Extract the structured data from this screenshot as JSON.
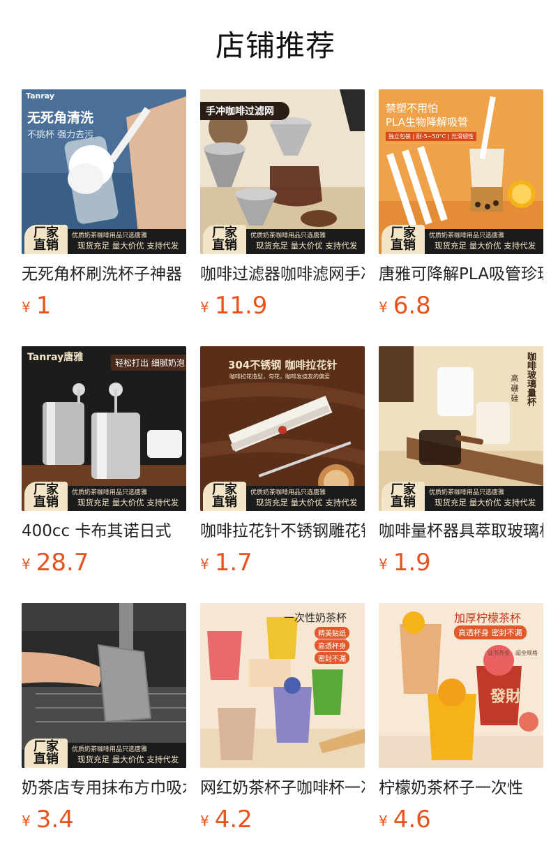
{
  "page": {
    "title": "店铺推荐"
  },
  "banner": {
    "badge_line1": "厂家",
    "badge_line2": "直销",
    "top_text": "优质奶茶咖啡用品只选唐雅",
    "bottom_text": "现货充足 量大价优 支持代发"
  },
  "currency": "¥",
  "colors": {
    "price": "#e8521c",
    "title": "#111111",
    "banner_bg": "#1b1b1b",
    "banner_text": "#f3e6c8"
  },
  "products": [
    {
      "name": "无死角杯刷洗杯子神器",
      "price": "1",
      "overlay": {
        "title": "无死角清洗",
        "subtitle": "不挑杯 强力去污",
        "brand": "Tanray"
      }
    },
    {
      "name": "咖啡过滤器咖啡滤网手冲",
      "price": "11.9",
      "overlay": {
        "title": "手冲咖啡过滤网"
      }
    },
    {
      "name": "唐雅可降解PLA吸管珍珠",
      "price": "6.8",
      "overlay": {
        "title": "禁塑不用怕",
        "subtitle": "PLA生物降解吸管",
        "tag": "独立包装 | 耐-5~50°C | 光滑韧性"
      }
    },
    {
      "name": "400cc 卡布其诺日式",
      "price": "28.7",
      "overlay": {
        "brand": "Tanray唐雅",
        "tag": "轻松打出 细腻奶泡"
      }
    },
    {
      "name": "咖啡拉花针不锈钢雕花针",
      "price": "1.7",
      "overlay": {
        "title": "304不锈钢 咖啡拉花针",
        "subtitle": "咖啡拉花造型，勾花，咖啡发烧友的偏爱"
      }
    },
    {
      "name": "咖啡量杯器具萃取玻璃杯",
      "price": "1.9",
      "overlay": {
        "title": "咖啡玻璃量杯",
        "subtitle": "高·硼·硅"
      }
    },
    {
      "name": "奶茶店专用抹布方巾吸水",
      "price": "3.4",
      "overlay": {}
    },
    {
      "name": "网红奶茶杯子咖啡杯一次性",
      "price": "4.2",
      "overlay": {
        "title": "一次性奶茶杯",
        "tags": [
          "精美贴纸",
          "高透杯身",
          "密封不漏"
        ]
      }
    },
    {
      "name": "柠檬奶茶杯子一次性",
      "price": "4.6",
      "overlay": {
        "title": "加厚柠檬茶杯",
        "subtitle": "高透杯身 密封不漏",
        "tags": [
          "证书齐全",
          "超全规格"
        ],
        "cup_text": "發財"
      }
    }
  ]
}
